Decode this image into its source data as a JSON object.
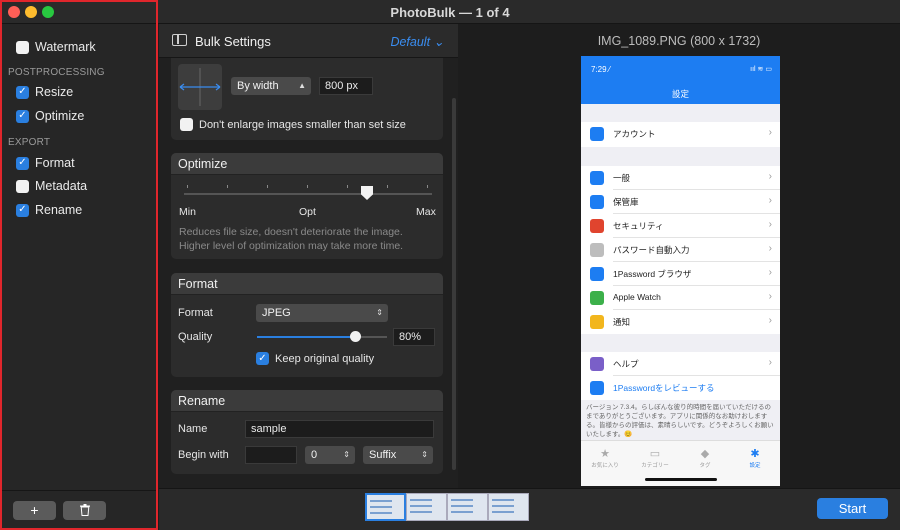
{
  "window": {
    "title": "PhotoBulk — 1 of 4"
  },
  "sidebar": {
    "items_top": [
      {
        "label": "Watermark",
        "checked": false
      }
    ],
    "postprocessing_heading": "POSTPROCESSING",
    "postprocessing": [
      {
        "label": "Resize",
        "checked": true
      },
      {
        "label": "Optimize",
        "checked": true
      }
    ],
    "export_heading": "EXPORT",
    "export": [
      {
        "label": "Format",
        "checked": true
      },
      {
        "label": "Metadata",
        "checked": false
      },
      {
        "label": "Rename",
        "checked": true
      }
    ],
    "add_label": "+",
    "delete_icon": "trash-icon"
  },
  "settings": {
    "title": "Bulk Settings",
    "preset": "Default",
    "resize": {
      "mode": "By width",
      "value": "800 px",
      "dont_enlarge_label": "Don't enlarge images smaller than set size",
      "dont_enlarge_checked": false
    },
    "optimize": {
      "title": "Optimize",
      "level": 0.67,
      "min_label": "Min",
      "opt_label": "Opt",
      "max_label": "Max",
      "help_line1": "Reduces file size, doesn't deteriorate the image.",
      "help_line2": "Higher level of optimization may take more time."
    },
    "format": {
      "title": "Format",
      "format_label": "Format",
      "format_value": "JPEG",
      "quality_label": "Quality",
      "quality_value": "80%",
      "quality_level": 0.8,
      "keep_original_label": "Keep original quality",
      "keep_original_checked": true
    },
    "rename": {
      "title": "Rename",
      "name_label": "Name",
      "name_value": "sample",
      "begin_label": "Begin with",
      "begin_value": "",
      "counter_value": "0",
      "position_value": "Suffix"
    }
  },
  "preview": {
    "title": "IMG_1089.PNG (800 x 1732)",
    "phone": {
      "time": "7:29 ⁄",
      "status": "ııl ≋ ▭",
      "header": "設定",
      "account": "アカウント",
      "rows": [
        {
          "label": "一般",
          "color": "#1d7df2"
        },
        {
          "label": "保管庫",
          "color": "#1d7df2"
        },
        {
          "label": "セキュリティ",
          "color": "#e0442e"
        },
        {
          "label": "パスワード自動入力",
          "color": "#bdbdbd"
        },
        {
          "label": "1Password ブラウザ",
          "color": "#1d7df2"
        },
        {
          "label": "Apple Watch",
          "color": "#3cb04a"
        },
        {
          "label": "通知",
          "color": "#f2b61d"
        }
      ],
      "help": "ヘルプ",
      "review": "1Passwordをレビューする",
      "footer": "バージョン 7.3.4。らしぼんな彼り的時間を届いていただけるのまでありがとうございます。アプリに関係的なお助けおしまする。皆様からの評価は、素晴らしいです。どうぞよろしくお願いいたします。😊",
      "tabs": [
        {
          "label": "お気に入り",
          "glyph": "★"
        },
        {
          "label": "カテゴリー",
          "glyph": "▭"
        },
        {
          "label": "タグ",
          "glyph": "◆"
        },
        {
          "label": "設定",
          "glyph": "✱"
        }
      ]
    }
  },
  "bottom": {
    "start_label": "Start"
  }
}
